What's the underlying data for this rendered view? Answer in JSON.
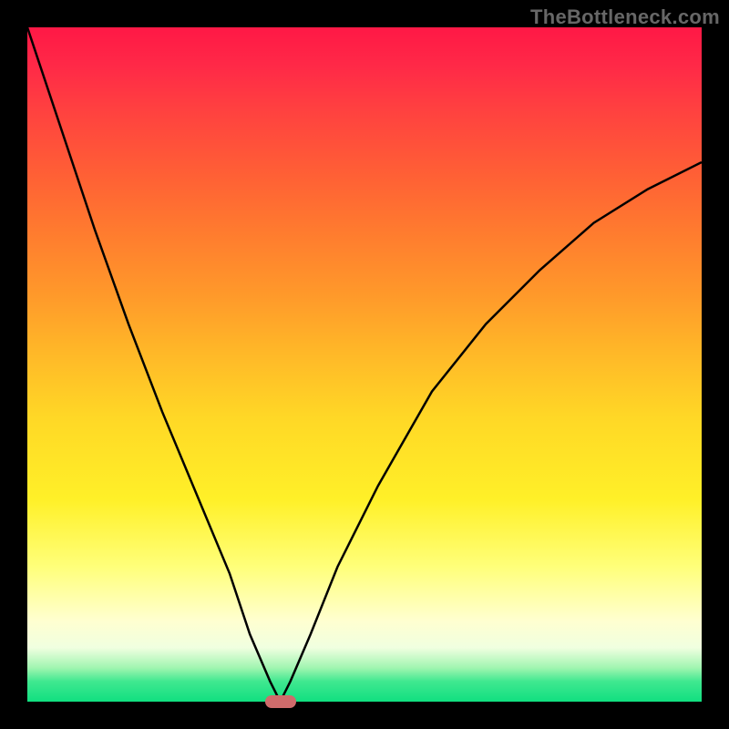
{
  "watermark": "TheBottleneck.com",
  "colors": {
    "background": "#000000",
    "curve": "#000000",
    "marker": "#cf6b6b",
    "gradient_top": "#ff1846",
    "gradient_bottom": "#10df80"
  },
  "chart_data": {
    "type": "line",
    "title": "",
    "xlabel": "",
    "ylabel": "",
    "xlim": [
      0,
      100
    ],
    "ylim": [
      0,
      100
    ],
    "x": [
      0,
      5,
      10,
      15,
      20,
      25,
      30,
      33,
      36,
      37.5,
      39,
      42,
      46,
      52,
      60,
      68,
      76,
      84,
      92,
      100
    ],
    "values": [
      100,
      85,
      70,
      56,
      43,
      31,
      19,
      10,
      3,
      0,
      3,
      10,
      20,
      32,
      46,
      56,
      64,
      71,
      76,
      80
    ],
    "series": [
      {
        "name": "curve",
        "x": [
          0,
          5,
          10,
          15,
          20,
          25,
          30,
          33,
          36,
          37.5,
          39,
          42,
          46,
          52,
          60,
          68,
          76,
          84,
          92,
          100
        ],
        "values": [
          100,
          85,
          70,
          56,
          43,
          31,
          19,
          10,
          3,
          0,
          3,
          10,
          20,
          32,
          46,
          56,
          64,
          71,
          76,
          80
        ]
      }
    ],
    "marker": {
      "x": 37.5,
      "y": 0
    },
    "grid": false,
    "legend": false
  }
}
